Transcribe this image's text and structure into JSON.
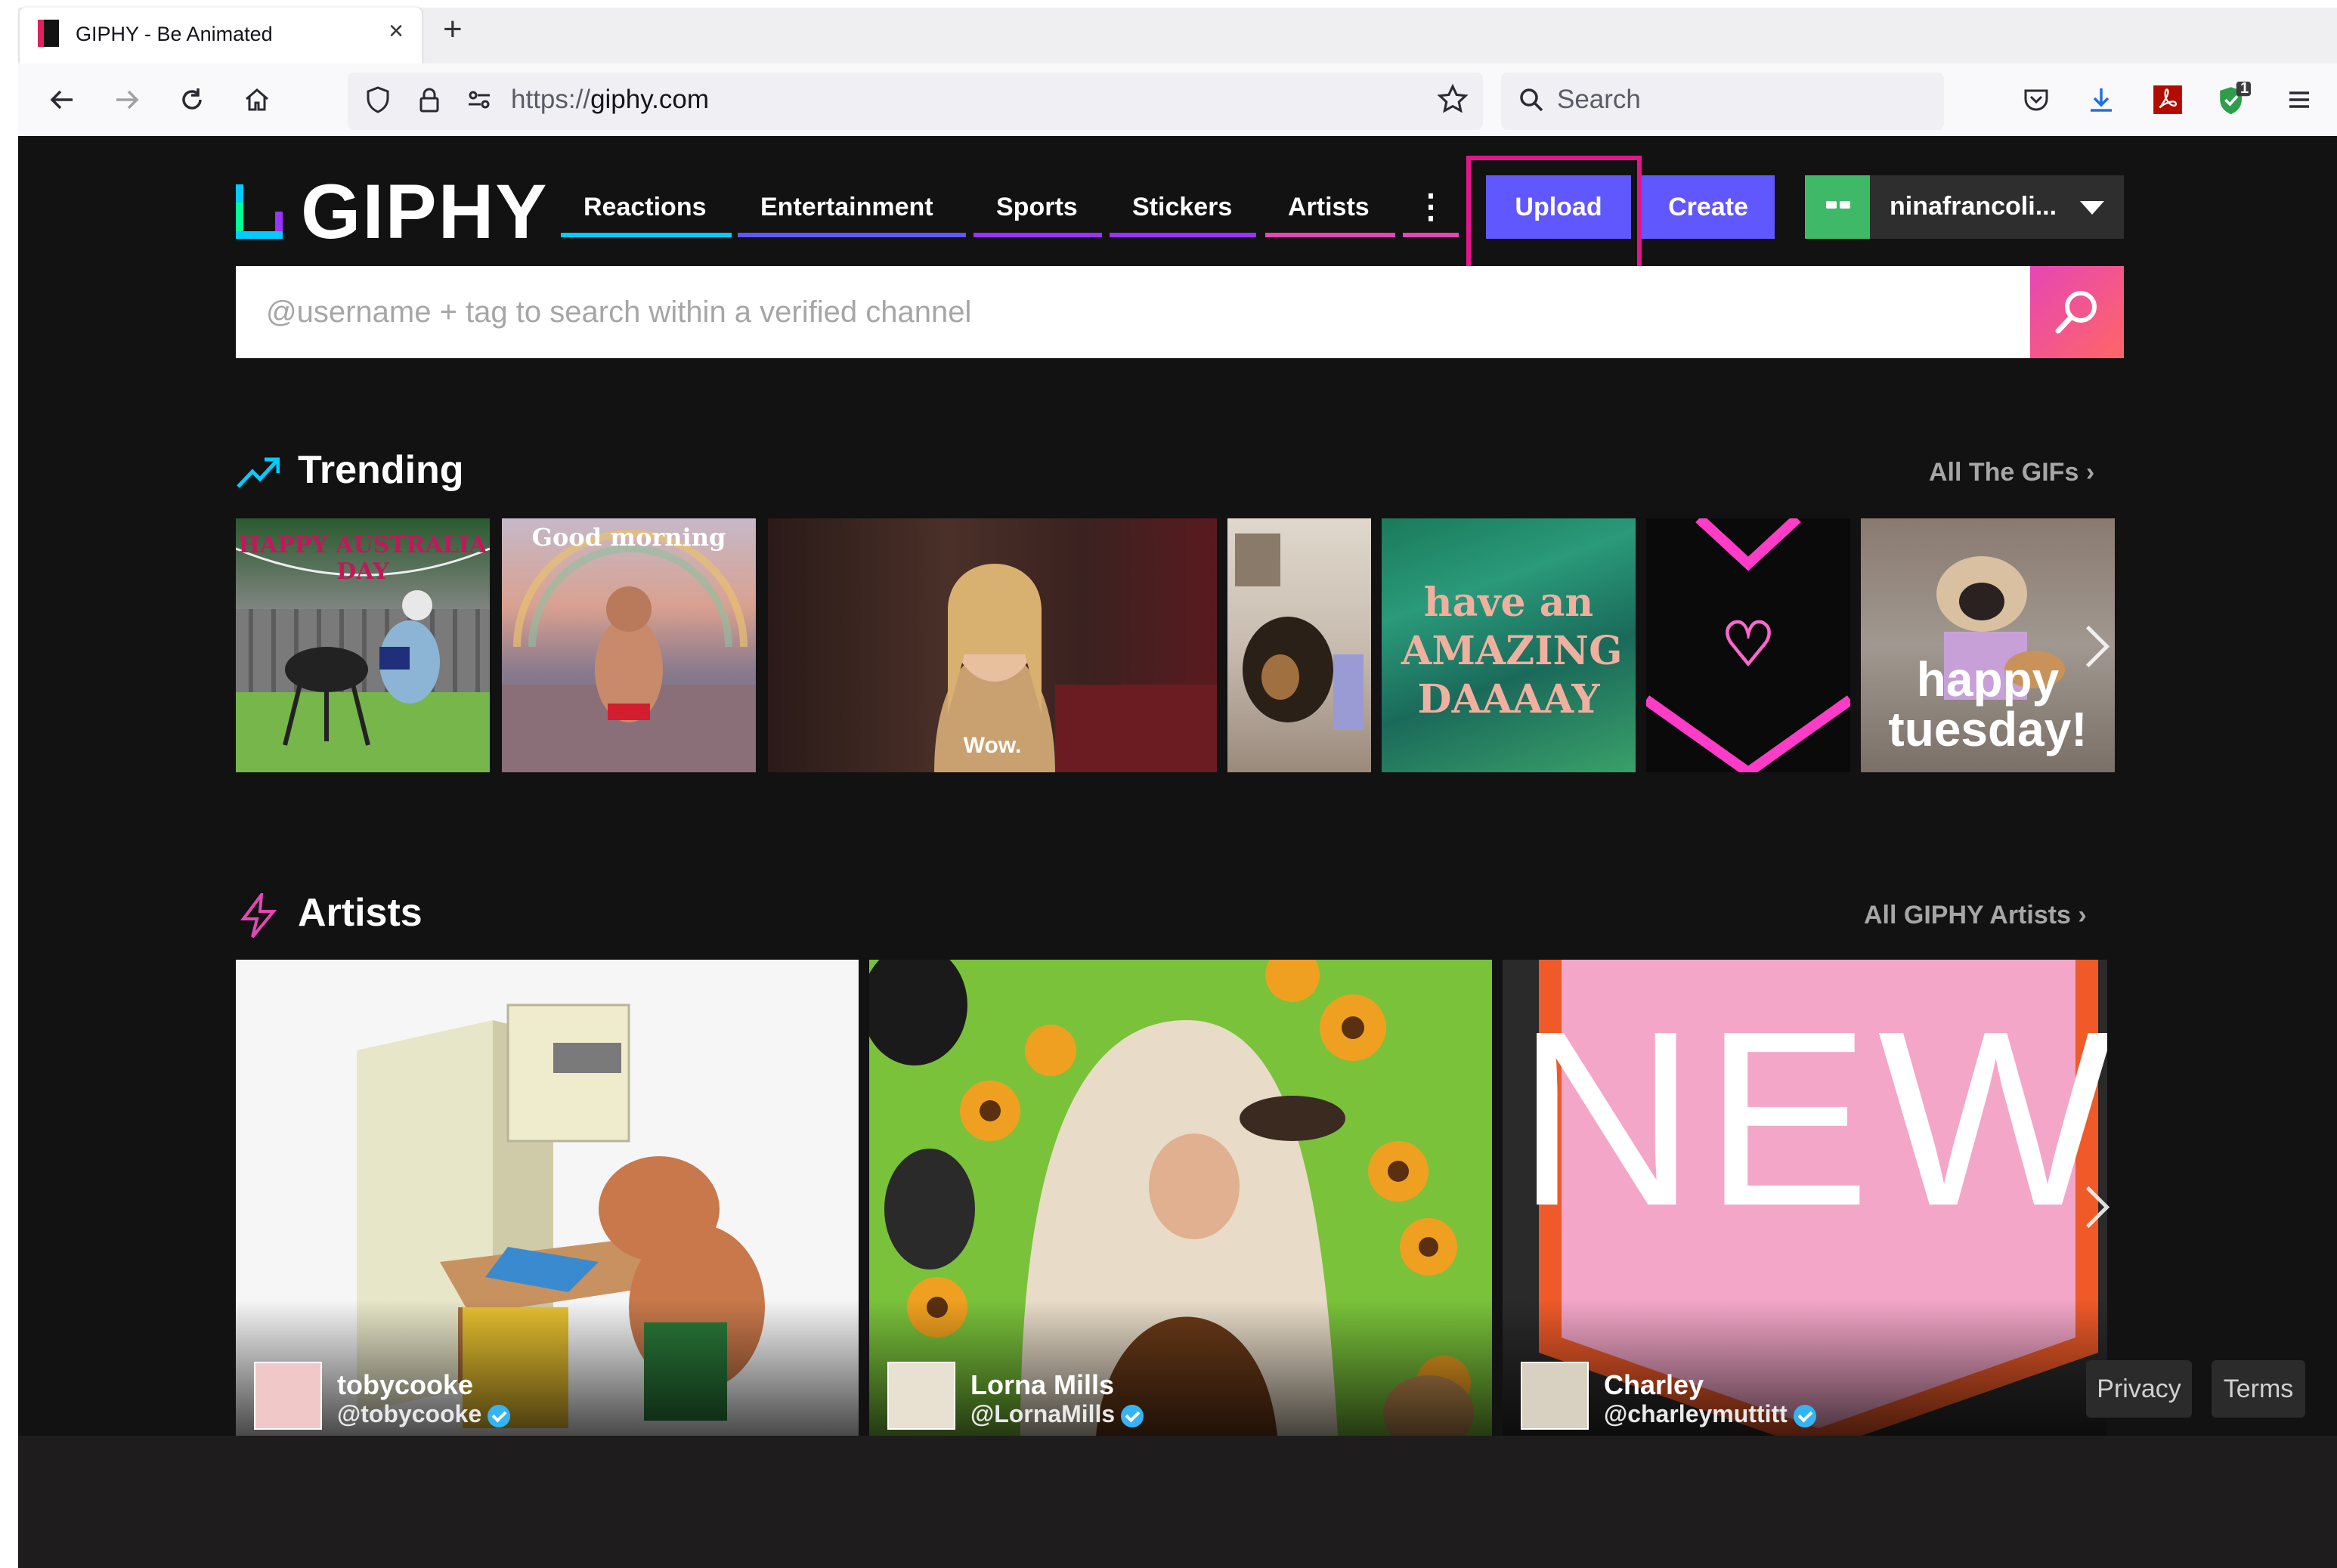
{
  "browser": {
    "tab_title": "GIPHY - Be Animated",
    "new_tab_symbol": "+",
    "close_symbol": "×",
    "url_scheme": "https://",
    "url_host": "giphy.com",
    "search_placeholder": "Search",
    "notification_count": "1"
  },
  "brand": {
    "logo_text": "GIPHY"
  },
  "nav": {
    "items": [
      {
        "label": "Reactions",
        "color": "#00ccff"
      },
      {
        "label": "Entertainment",
        "color": "#6157ff"
      },
      {
        "label": "Sports",
        "color": "#9933ff"
      },
      {
        "label": "Stickers",
        "color": "#9933ff"
      },
      {
        "label": "Artists",
        "color": "#e646b6"
      }
    ],
    "more_symbol": "⋮",
    "upload_label": "Upload",
    "create_label": "Create",
    "username": "ninafrancoli..."
  },
  "search": {
    "placeholder": "@username + tag to search within a verified channel"
  },
  "trending": {
    "title": "Trending",
    "link": "All The GIFs",
    "gifs": [
      {
        "caption": "HAPPY AUSTRALIA DAY"
      },
      {
        "caption": "Good morning"
      },
      {
        "caption": "Wow."
      },
      {
        "caption": ""
      },
      {
        "caption": "have an AMAZING DAAAAY"
      },
      {
        "caption": "♡"
      },
      {
        "caption": "happy tuesday!"
      }
    ]
  },
  "artists": {
    "title": "Artists",
    "link": "All GIPHY Artists",
    "cards": [
      {
        "name": "tobycooke",
        "handle": "@tobycooke"
      },
      {
        "name": "Lorna Mills",
        "handle": "@LornaMills"
      },
      {
        "name": "Charley",
        "handle": "@charleymuttitt",
        "art_text": "NEW"
      }
    ]
  },
  "footer": {
    "privacy": "Privacy",
    "terms": "Terms"
  }
}
